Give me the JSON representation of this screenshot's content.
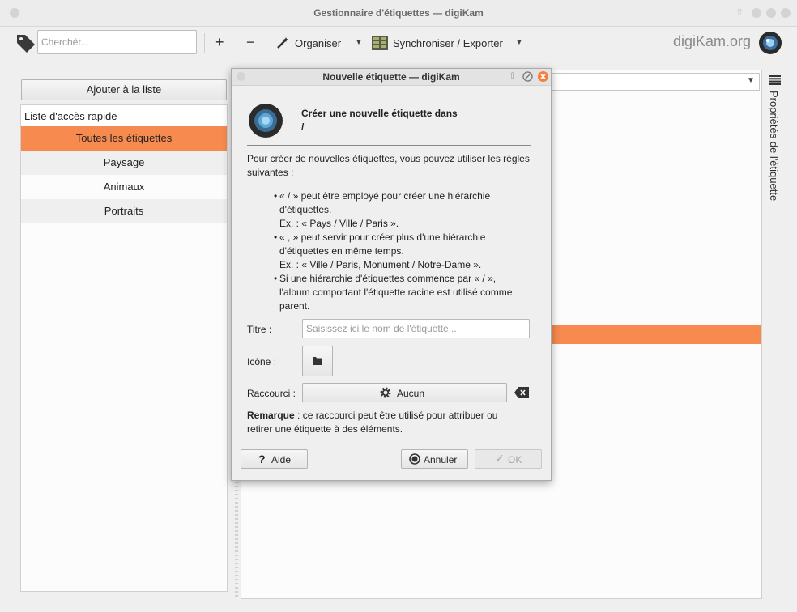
{
  "window": {
    "title": "Gestionnaire d'étiquettes — digiKam"
  },
  "toolbar": {
    "search_placeholder": "Cherchér...",
    "add_symbol": "+",
    "remove_symbol": "−",
    "organize_label": "Organiser",
    "sync_label": "Synchroniser / Exporter",
    "brand": "digiKam.org"
  },
  "left": {
    "add_button": "Ajouter à la liste",
    "quick_access": "Liste d'accès rapide",
    "tags": [
      "Toutes les étiquettes",
      "Paysage",
      "Animaux",
      "Portraits"
    ]
  },
  "right": {
    "properties_label": "Propriétés de l'étiquette"
  },
  "dialog": {
    "title": "Nouvelle étiquette — digiKam",
    "heading_line1": "Créer une nouvelle étiquette dans",
    "heading_line2": "/",
    "intro": "Pour créer de nouvelles étiquettes, vous pouvez utiliser les règles suivantes :",
    "rules": [
      {
        "l1": "« / » peut être employé pour créer une hiérarchie",
        "l2": "d'étiquettes.",
        "l3": "Ex. : « Pays / Ville / Paris »."
      },
      {
        "l1": "« , » peut servir pour créer plus d'une hiérarchie",
        "l2": "d'étiquettes en même temps.",
        "l3": "Ex. : « Ville / Paris, Monument / Notre-Dame »."
      },
      {
        "l1": "Si une hiérarchie d'étiquettes commence par « / »,",
        "l2": "l'album comportant l'étiquette racine est utilisé comme",
        "l3": "parent."
      }
    ],
    "title_label": "Titre :",
    "title_placeholder": "Saisissez ici le nom de l'étiquette...",
    "icon_label": "Icône :",
    "shortcut_label": "Raccourci :",
    "shortcut_value": "Aucun",
    "remark_bold": "Remarque",
    "remark_text": " : ce raccourci peut être utilisé pour attribuer ou",
    "remark_line2": "retirer une étiquette à des éléments.",
    "help_button": "Aide",
    "cancel_button": "Annuler",
    "ok_button": "OK"
  },
  "colors": {
    "accent": "#f68a4f",
    "accent_light": "#f9a36e"
  }
}
